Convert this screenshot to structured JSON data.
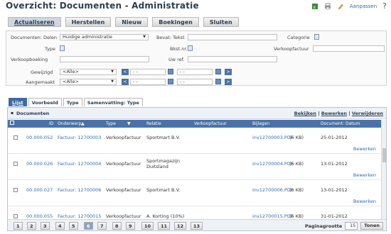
{
  "page_title": "Overzicht: Documenten - Administratie",
  "top": {
    "edit_label": "Aanpassen",
    "help_label": "?"
  },
  "toolbar": [
    "Actualiseren",
    "Herstellen",
    "Nieuw",
    "Boekingen",
    "Sluiten"
  ],
  "filter": {
    "documenten_label": "Documenten: Delen",
    "documenten_value": "Huidige administratie",
    "bevat_label": "Bevat: Tekst",
    "categorie_label": "Categorie",
    "type_label": "Type",
    "bkst_label": "Bkst.nr.",
    "verkoopfactuur_label": "Verkoopfactuur",
    "verkoopboeking_label": "Verkoopboeking",
    "uwref_label": "Uw ref.",
    "gewijzigd_label": "Gewijzigd",
    "gewijzigd_value": "<Alle>",
    "aangemaakt_label": "Aangemaakt",
    "aangemaakt_value": "<Alle>",
    "date_placeholder": "- -",
    "prev": "<",
    "next": ">"
  },
  "tabs": [
    "Lijst",
    "Voorbeeld",
    "Type",
    "Samenvatting: Type"
  ],
  "grid": {
    "title": "Documenten",
    "actions": [
      "Bekijken",
      "Bewerken",
      "Verwijderen"
    ],
    "separator": "|",
    "columns": [
      "ID",
      "Onderwerp",
      "Type",
      "Relatie",
      "Verkoopfactuur",
      "Bijlagen",
      "Document: Datum"
    ],
    "rows": [
      {
        "id": "00.000.052",
        "subject": "Factuur: 12700003",
        "type": "Verkoopfactuur",
        "relation": "Sportmart B.V.",
        "relation2": "",
        "file": "inv12700003.PDF",
        "size": "(6 KB)",
        "date": "25-01-2012",
        "action": "Bewerken"
      },
      {
        "id": "00.000.026",
        "subject": "Factuur: 12700004",
        "type": "Verkoopfactuur",
        "relation": "Sportmagazijn",
        "relation2": "Duitsland",
        "file": "inv12700004.PDF",
        "size": "(6 KB)",
        "date": "13-01-2012",
        "action": "Bewerken"
      },
      {
        "id": "00.000.027",
        "subject": "Factuur: 12700006",
        "type": "Verkoopfactuur",
        "relation": "Sportmart B.V.",
        "relation2": "",
        "file": "inv12700006.PDF",
        "size": "(6 KB)",
        "date": "13-01-2012",
        "action": "Bewerken"
      },
      {
        "id": "00.000.055",
        "subject": "Factuur: 12700015",
        "type": "Verkoopfactuur",
        "relation": "A. Korting (10%)",
        "relation2": "",
        "file": "inv12700015.PDF",
        "size": "(6 KB)",
        "date": "31-01-2012",
        "action": ""
      }
    ]
  },
  "pager": {
    "pages": [
      "1",
      "2",
      "3",
      "4",
      "5",
      "6",
      "7",
      "8",
      "9",
      "10",
      "11",
      "12",
      "13"
    ],
    "current": "6",
    "size_label": "Paginagrootte",
    "size_value": "15",
    "show_label": "Tonen"
  }
}
